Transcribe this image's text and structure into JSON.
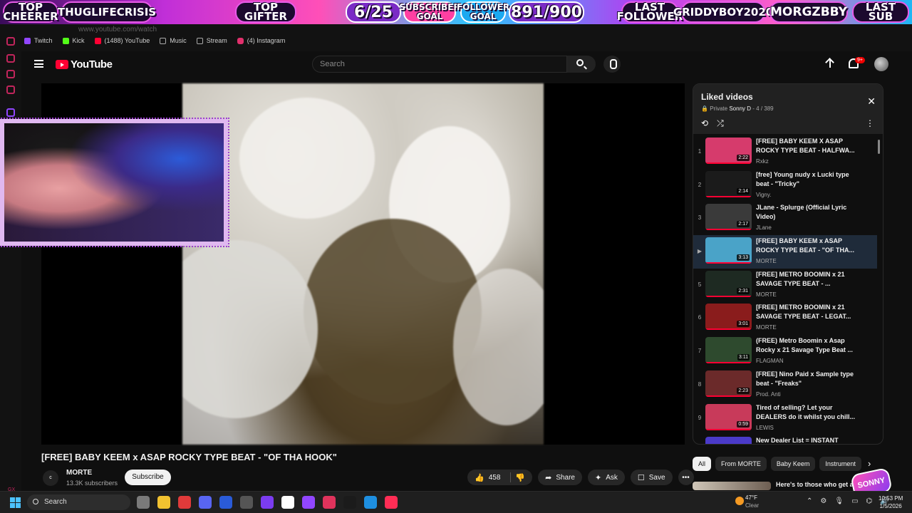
{
  "overlay": {
    "top_cheerer": "TOP\nCHEERER",
    "top_cheerer_name": "THUGLIFECRISIS",
    "top_gifter": "TOP\nGIFTER",
    "sub_count": "6/25",
    "subscriber_goal": "SUBSCRIBER\nGOAL",
    "follower_goal": "FOLLOWER\nGOAL",
    "follower_count": "891/900",
    "last_follower": "LAST\nFOLLOWER",
    "last_follower_name": "GRIDDYBOY2020",
    "last_sub_name": "MORGZBBY",
    "last_sub": "LAST\nSUB"
  },
  "browser": {
    "address": "www.youtube.com/watch",
    "bookmarks": [
      {
        "label": "Twitch",
        "color": "#9146ff"
      },
      {
        "label": "Kick",
        "color": "#53fc18"
      },
      {
        "label": "(1488) YouTube",
        "color": "#ff0033"
      },
      {
        "label": "Music",
        "color": "#aaaaaa"
      },
      {
        "label": "Stream",
        "color": "#aaaaaa"
      },
      {
        "label": "(4) Instagram",
        "color": "#e1306c"
      }
    ],
    "gx_label": "GX"
  },
  "header": {
    "logo_text": "YouTube",
    "search_placeholder": "Search",
    "notification_badge": "9+"
  },
  "video": {
    "title": "[FREE] BABY KEEM x ASAP ROCKY TYPE BEAT - \"OF THA HOOK\"",
    "channel_name": "MORTE",
    "channel_avatar_text": "c",
    "subscribers": "13.3K subscribers",
    "subscribe_label": "Subscribe",
    "likes": "458",
    "share_label": "Share",
    "ask_label": "Ask",
    "save_label": "Save"
  },
  "playlist": {
    "title": "Liked videos",
    "privacy": "Private",
    "owner": "Sonny D",
    "position": "4 / 389",
    "items": [
      {
        "index": "1",
        "title": "[FREE] BABY KEEM X ASAP ROCKY TYPE BEAT - HALFWA...",
        "channel": "Rxkz",
        "duration": "2:22",
        "thumb": "#d63b6c",
        "active": false
      },
      {
        "index": "2",
        "title": "[free] Young nudy x Lucki type beat - \"Tricky\"",
        "channel": "Vigny.",
        "duration": "2:14",
        "thumb": "#1b1b1b",
        "active": false
      },
      {
        "index": "3",
        "title": "JLane - Splurge (Official Lyric Video)",
        "channel": "JLane",
        "duration": "2:17",
        "thumb": "#3a3a3a",
        "active": false
      },
      {
        "index": "▶",
        "title": "[FREE] BABY KEEM x ASAP ROCKY TYPE BEAT - \"OF THA...",
        "channel": "MORTE",
        "duration": "3:13",
        "thumb": "#4aa3c8",
        "active": true
      },
      {
        "index": "5",
        "title": "[FREE] METRO BOOMIN x 21 SAVAGE TYPE BEAT - ...",
        "channel": "MORTE",
        "duration": "2:31",
        "thumb": "#1e2a22",
        "active": false
      },
      {
        "index": "6",
        "title": "[FREE] METRO BOOMIN x 21 SAVAGE TYPE BEAT - LEGAT...",
        "channel": "MORTE",
        "duration": "3:01",
        "thumb": "#8a1c1c",
        "active": false
      },
      {
        "index": "7",
        "title": "(FREE) Metro Boomin x Asap Rocky x 21 Savage Type Beat ...",
        "channel": "FLAGMAN",
        "duration": "3:11",
        "thumb": "#2e4a2e",
        "active": false
      },
      {
        "index": "8",
        "title": "[FREE] Nino Paid x Sample type beat - \"Freaks\"",
        "channel": "Prod. Anti",
        "duration": "2:23",
        "thumb": "#6b2a2a",
        "active": false
      },
      {
        "index": "9",
        "title": "Tired of selling? Let your DEALERS do it whilst you chill...",
        "channel": "LEWIS",
        "duration": "0:59",
        "thumb": "#c83a5a",
        "active": false
      },
      {
        "index": "",
        "title": "New Dealer List = INSTANT",
        "channel": "",
        "duration": "",
        "thumb": "#4a3ac8",
        "active": false
      }
    ]
  },
  "chips": [
    "All",
    "From MORTE",
    "Baby Keem",
    "Instrument"
  ],
  "next_video_title": "Here's to those who get aft",
  "sonny_badge": "SONNY",
  "taskbar": {
    "search_label": "Search",
    "weather_temp": "47°F",
    "weather_cond": "Clear",
    "time": "10:53 PM",
    "date": "1/5/2026",
    "apps": [
      "#7a7a7a",
      "#f2c230",
      "#e03a3a",
      "#5865f2",
      "#2a5bd8",
      "#555555",
      "#7b3cf0",
      "#ffffff",
      "#9146ff",
      "#e0335c",
      "#1b1b1b",
      "#1e8fe0",
      "#ff2d55"
    ]
  }
}
